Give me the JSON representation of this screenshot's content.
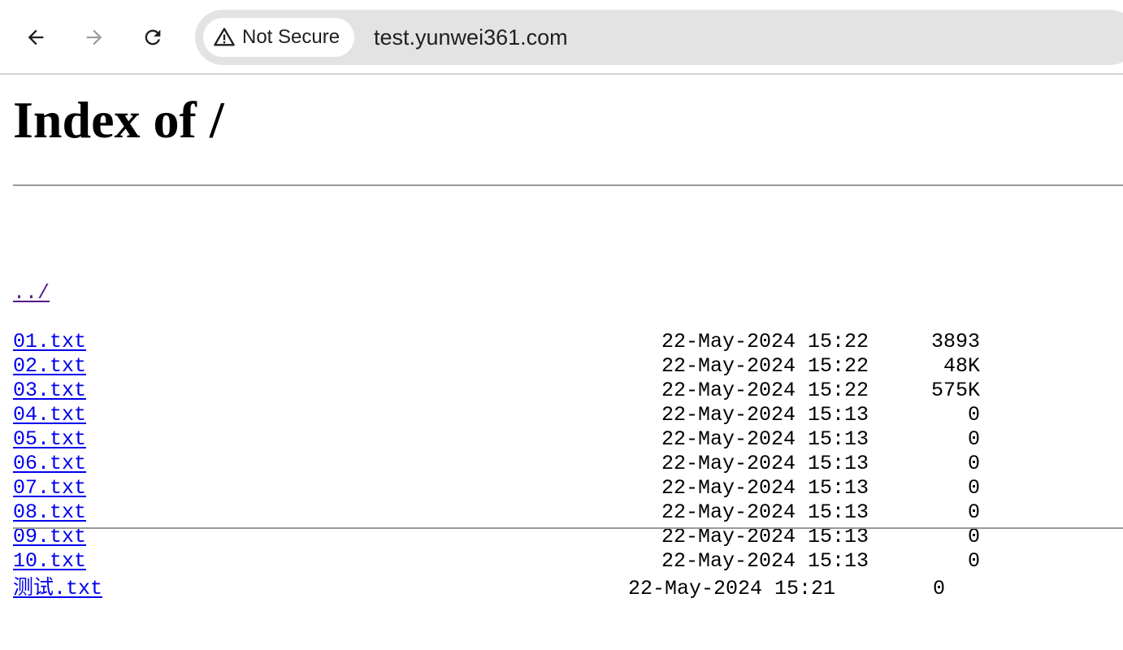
{
  "browser": {
    "security_label": "Not Secure",
    "url": "test.yunwei361.com"
  },
  "page": {
    "title": "Index of /",
    "parent_link": "../",
    "files": [
      {
        "name": "01.txt",
        "date": "22-May-2024 15:22",
        "size": "3893"
      },
      {
        "name": "02.txt",
        "date": "22-May-2024 15:22",
        "size": "48K"
      },
      {
        "name": "03.txt",
        "date": "22-May-2024 15:22",
        "size": "575K"
      },
      {
        "name": "04.txt",
        "date": "22-May-2024 15:13",
        "size": "0"
      },
      {
        "name": "05.txt",
        "date": "22-May-2024 15:13",
        "size": "0"
      },
      {
        "name": "06.txt",
        "date": "22-May-2024 15:13",
        "size": "0"
      },
      {
        "name": "07.txt",
        "date": "22-May-2024 15:13",
        "size": "0"
      },
      {
        "name": "08.txt",
        "date": "22-May-2024 15:13",
        "size": "0"
      },
      {
        "name": "09.txt",
        "date": "22-May-2024 15:13",
        "size": "0"
      },
      {
        "name": "10.txt",
        "date": "22-May-2024 15:13",
        "size": "0"
      },
      {
        "name": "测试.txt",
        "date": "22-May-2024 15:21",
        "size": "0"
      }
    ]
  },
  "colors": {
    "link": "#0000ee",
    "visited_link": "#551a8b"
  },
  "icons": {
    "back": "arrow-left-icon",
    "forward": "arrow-right-icon",
    "reload": "reload-icon",
    "security": "warning-triangle-icon"
  }
}
